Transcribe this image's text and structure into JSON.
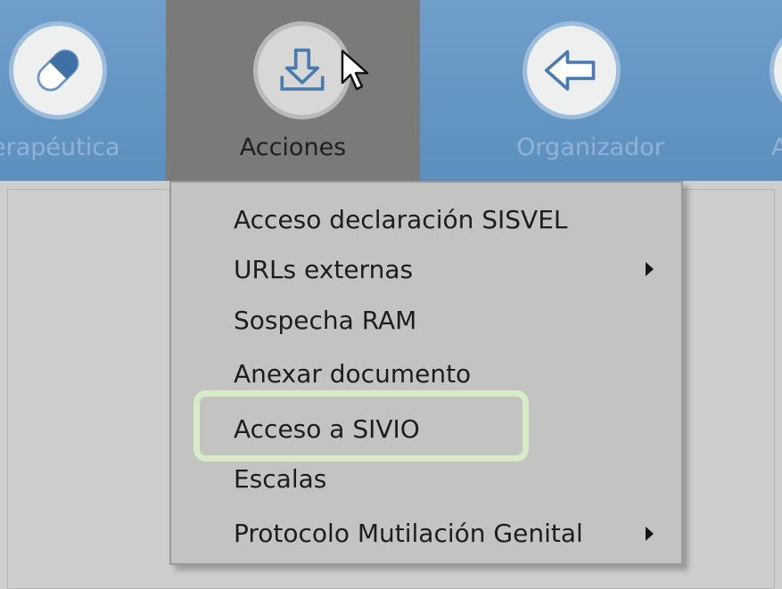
{
  "toolbar": {
    "items": [
      {
        "label": "erapéutica",
        "icon": "pill-icon"
      },
      {
        "label": "Acciones",
        "icon": "download-icon"
      },
      {
        "label": "Organizador",
        "icon": "back-arrow-icon"
      },
      {
        "label": "A",
        "icon": "partial-icon"
      }
    ]
  },
  "menu": {
    "items": [
      {
        "label": "Acceso declaración SISVEL",
        "submenu": false
      },
      {
        "label": "URLs externas",
        "submenu": true
      },
      {
        "label": "Sospecha RAM",
        "submenu": false
      },
      {
        "label": "Anexar documento",
        "submenu": false
      },
      {
        "label": "Acceso a SIVIO",
        "submenu": false,
        "highlighted": true
      },
      {
        "label": "Escalas",
        "submenu": false
      },
      {
        "label": "Protocolo Mutilación Genital",
        "submenu": true
      }
    ]
  },
  "colors": {
    "toolbar": "#6f9ec9",
    "active_tab": "#7a7a78",
    "menu_bg": "#c3c4c1",
    "highlight_border": "#d6ebc6"
  }
}
